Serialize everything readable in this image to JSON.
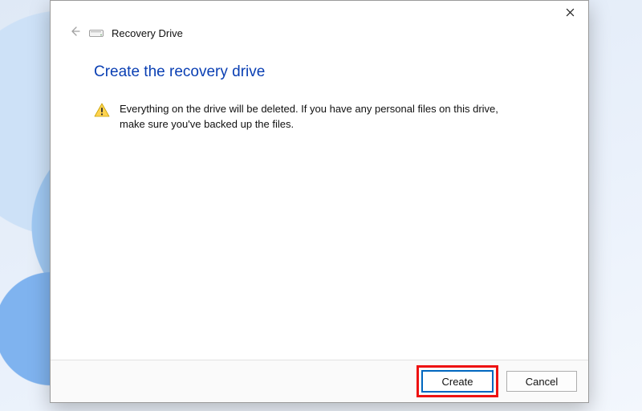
{
  "window": {
    "app_title": "Recovery Drive",
    "heading": "Create the recovery drive",
    "warning_text": "Everything on the drive will be deleted. If you have any personal files on this drive, make sure you've backed up the files."
  },
  "footer": {
    "create_label": "Create",
    "cancel_label": "Cancel"
  }
}
